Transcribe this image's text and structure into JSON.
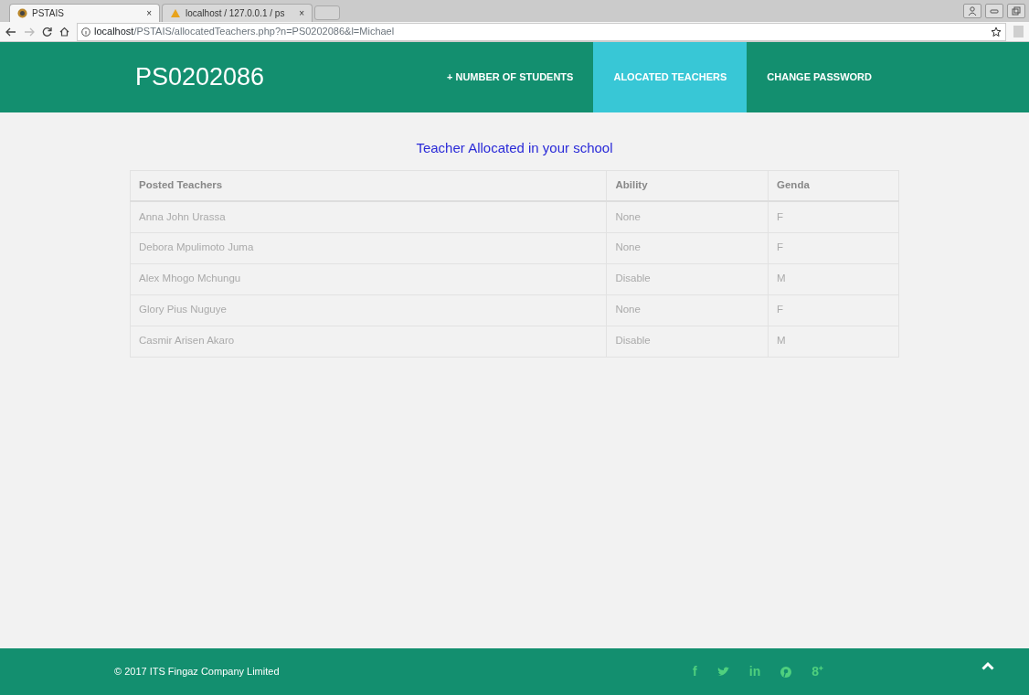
{
  "browser": {
    "tabs": [
      {
        "title": "PSTAIS",
        "close": "×",
        "selected": true
      },
      {
        "title": "localhost / 127.0.0.1 / ps",
        "close": "×",
        "selected": false
      }
    ],
    "url_host": "localhost",
    "url_path": "/PSTAIS/allocatedTeachers.php?n=PS0202086&l=Michael"
  },
  "navbar": {
    "brand": "PS0202086",
    "links": [
      {
        "label": "+ NUMBER OF STUDENTS",
        "selected": false
      },
      {
        "label": "ALOCATED TEACHERS",
        "selected": true
      },
      {
        "label": "CHANGE PASSWORD",
        "selected": false
      }
    ]
  },
  "heading": "Teacher Allocated in your school",
  "table": {
    "columns": [
      "Posted Teachers",
      "Ability",
      "Genda"
    ],
    "rows": [
      [
        "Anna John Urassa",
        "None",
        "F"
      ],
      [
        "Debora Mpulimoto Juma",
        "None",
        "F"
      ],
      [
        "Alex Mhogo Mchungu",
        "Disable",
        "M"
      ],
      [
        "Glory Pius Nuguye",
        "None",
        "F"
      ],
      [
        "Casmir Arisen Akaro",
        "Disable",
        "M"
      ]
    ]
  },
  "footer": {
    "copyright": "© 2017 ITS Fingaz Company Limited",
    "social": [
      {
        "kind": "text",
        "label": "f"
      },
      {
        "kind": "bird"
      },
      {
        "kind": "text",
        "label": "in"
      },
      {
        "kind": "pin"
      },
      {
        "kind": "text",
        "label": "8⁺"
      }
    ]
  }
}
